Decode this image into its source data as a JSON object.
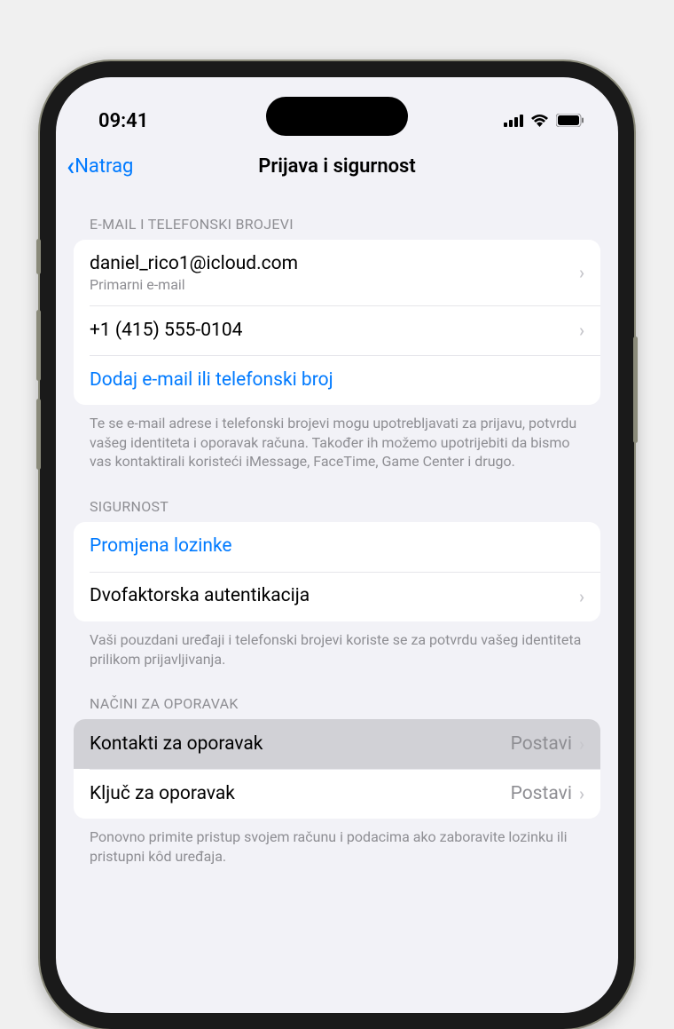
{
  "status": {
    "time": "09:41"
  },
  "nav": {
    "back": "Natrag",
    "title": "Prijava i sigurnost"
  },
  "sections": {
    "email_phone": {
      "header": "E-MAIL I TELEFONSKI BROJEVI",
      "email": "daniel_rico1@icloud.com",
      "email_subtitle": "Primarni e-mail",
      "phone": "+1 (415) 555-0104",
      "add_action": "Dodaj e-mail ili telefonski broj",
      "footer": "Te se e-mail adrese i telefonski brojevi mogu upotrebljavati za prijavu, potvrdu vašeg identiteta i oporavak računa. Također ih možemo upotrijebiti da bismo vas kontaktirali koristeći iMessage, FaceTime, Game Center i drugo."
    },
    "security": {
      "header": "SIGURNOST",
      "change_password": "Promjena lozinke",
      "two_factor": "Dvofaktorska autentikacija",
      "footer": "Vaši pouzdani uređaji i telefonski brojevi koriste se za potvrdu vašeg identiteta prilikom prijavljivanja."
    },
    "recovery": {
      "header": "NAČINI ZA OPORAVAK",
      "contacts": "Kontakti za oporavak",
      "contacts_detail": "Postavi",
      "key": "Ključ za oporavak",
      "key_detail": "Postavi",
      "footer": "Ponovno primite pristup svojem računu i podacima ako zaboravite lozinku ili pristupni kôd uređaja."
    }
  }
}
